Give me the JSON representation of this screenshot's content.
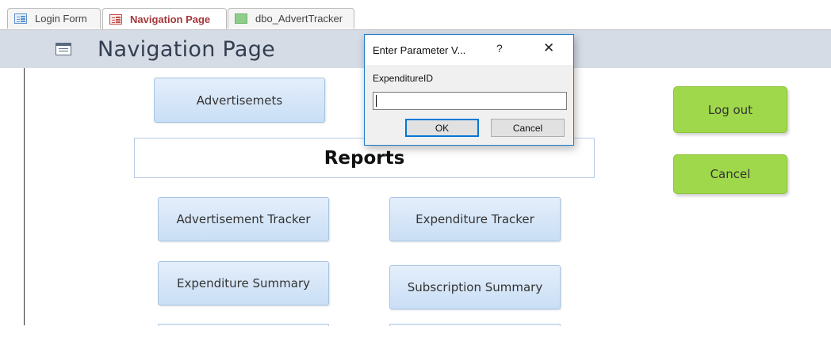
{
  "tabs": [
    {
      "label": "Login Form",
      "icon": "form-icon",
      "active": false
    },
    {
      "label": "Navigation Page",
      "icon": "form-icon",
      "active": true
    },
    {
      "label": "dbo_AdvertTracker",
      "icon": "table-icon",
      "active": false
    }
  ],
  "header": {
    "title": "Navigation Page",
    "icon": "form-icon"
  },
  "buttons": {
    "advertisements": "Advertisemets",
    "advertisement_tracker": "Advertisement Tracker",
    "expenditure_tracker": "Expenditure Tracker",
    "expenditure_summary": "Expenditure Summary",
    "subscription_summary": "Subscription Summary",
    "log_out": "Log out",
    "cancel": "Cancel"
  },
  "reports_label": "Reports",
  "dialog": {
    "title": "Enter Parameter V...",
    "help": "?",
    "close": "✕",
    "field_label": "ExpenditureID",
    "field_value": "",
    "ok_label": "OK",
    "cancel_label": "Cancel"
  },
  "colors": {
    "accent_tab_text": "#a4373a",
    "header_band": "#d6dce6",
    "button_blue": "#c9def5",
    "button_green": "#9fd84a",
    "dialog_border": "#1979ca"
  }
}
